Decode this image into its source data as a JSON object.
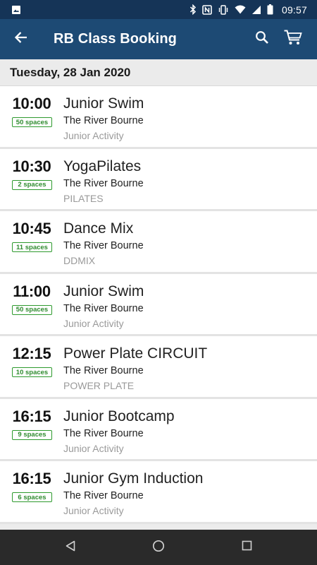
{
  "status_bar": {
    "time": "09:57",
    "icons": [
      "image-notification-icon",
      "bluetooth-icon",
      "nfc-icon",
      "vibrate-icon",
      "wifi-icon",
      "signal-icon",
      "battery-icon"
    ]
  },
  "app_bar": {
    "title": "RB Class Booking",
    "icons": [
      "back-arrow-icon",
      "search-icon",
      "cart-icon"
    ]
  },
  "date_header": "Tuesday, 28 Jan 2020",
  "classes": [
    {
      "time": "10:00",
      "spaces": "50 spaces",
      "name": "Junior Swim",
      "venue": "The River Bourne",
      "category": "Junior Activity"
    },
    {
      "time": "10:30",
      "spaces": "2 spaces",
      "name": "YogaPilates",
      "venue": "The River Bourne",
      "category": "PILATES"
    },
    {
      "time": "10:45",
      "spaces": "11 spaces",
      "name": "Dance Mix",
      "venue": "The River Bourne",
      "category": "DDMIX"
    },
    {
      "time": "11:00",
      "spaces": "50 spaces",
      "name": "Junior Swim",
      "venue": "The River Bourne",
      "category": "Junior Activity"
    },
    {
      "time": "12:15",
      "spaces": "10 spaces",
      "name": "Power Plate CIRCUIT",
      "venue": "The River Bourne",
      "category": "POWER PLATE"
    },
    {
      "time": "16:15",
      "spaces": "9 spaces",
      "name": "Junior Bootcamp",
      "venue": "The River Bourne",
      "category": "Junior Activity"
    },
    {
      "time": "16:15",
      "spaces": "6 spaces",
      "name": "Junior Gym Induction",
      "venue": "The River Bourne",
      "category": "Junior Activity"
    }
  ],
  "nav_bar": {
    "icons": [
      "back-triangle-icon",
      "home-circle-icon",
      "recents-square-icon"
    ]
  },
  "colors": {
    "status_bar": "#153457",
    "app_bar": "#1d4a74",
    "spaces_badge": "#2e8b2e",
    "nav_bar": "#2a2a2a"
  }
}
